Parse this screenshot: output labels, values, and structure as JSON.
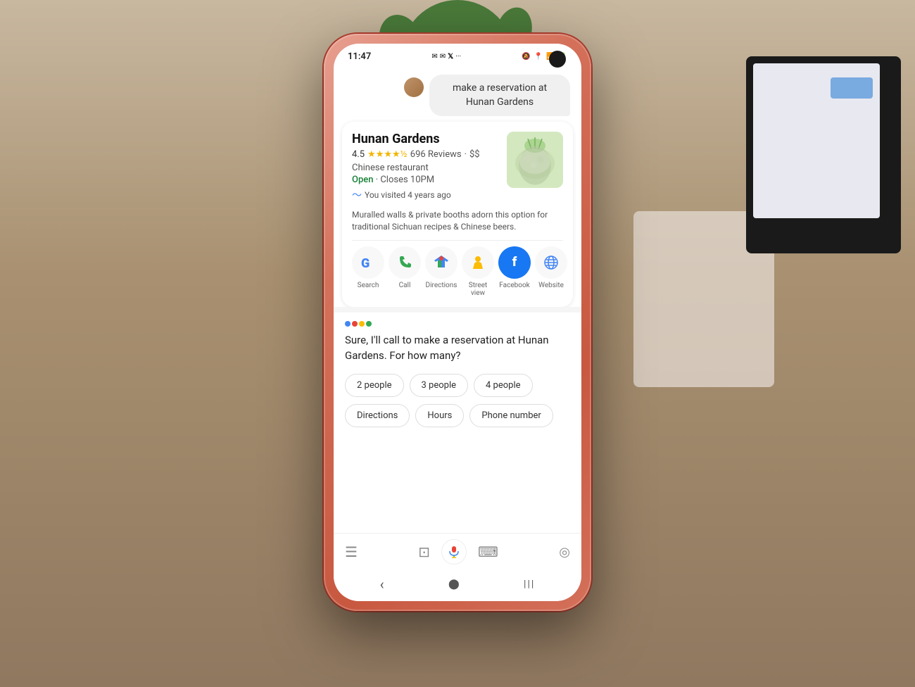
{
  "background": {
    "color": "#a89070"
  },
  "phone": {
    "status_bar": {
      "time": "11:47",
      "notification_icons": "✉ ✉ 𝕏 ···",
      "right_icons": "🔕 📍 📶 🔋"
    },
    "user_query": {
      "text": "make a reservation at Hunan Gardens"
    },
    "place_card": {
      "title": "Hunan Gardens",
      "rating": "4.5",
      "stars": "★★★★½",
      "review_count": "696 Reviews",
      "price": "$$",
      "type": "Chinese restaurant",
      "status": "Open",
      "separator": "·",
      "closes": "Closes 10PM",
      "visit_text": "You visited 4 years ago",
      "description": "Muralled walls & private booths adorn this option for traditional Sichuan recipes & Chinese beers.",
      "actions": [
        {
          "id": "search",
          "label": "Search",
          "icon": "G"
        },
        {
          "id": "call",
          "label": "Call",
          "icon": "📞"
        },
        {
          "id": "directions",
          "label": "Directions",
          "icon": "🗺"
        },
        {
          "id": "street-view",
          "label": "Street view",
          "icon": "🟡"
        },
        {
          "id": "facebook",
          "label": "Facebook",
          "icon": "f"
        },
        {
          "id": "website",
          "label": "Website",
          "icon": "🌐"
        }
      ]
    },
    "assistant_response": {
      "text": "Sure, I'll call to make a reservation at Hunan Gardens. For how many?",
      "chips": [
        {
          "id": "2-people",
          "label": "2 people"
        },
        {
          "id": "3-people",
          "label": "3 people"
        },
        {
          "id": "4-people",
          "label": "4 people"
        }
      ],
      "secondary_chips": [
        {
          "id": "directions",
          "label": "Directions"
        },
        {
          "id": "hours",
          "label": "Hours"
        },
        {
          "id": "phone-number",
          "label": "Phone number"
        }
      ]
    },
    "bottom_bar": {
      "icons": [
        "☰",
        "⊡",
        "🎤",
        "⌨",
        "◎"
      ]
    },
    "nav_bar": {
      "back": "‹",
      "home": "⬤",
      "recents": "|||"
    }
  }
}
